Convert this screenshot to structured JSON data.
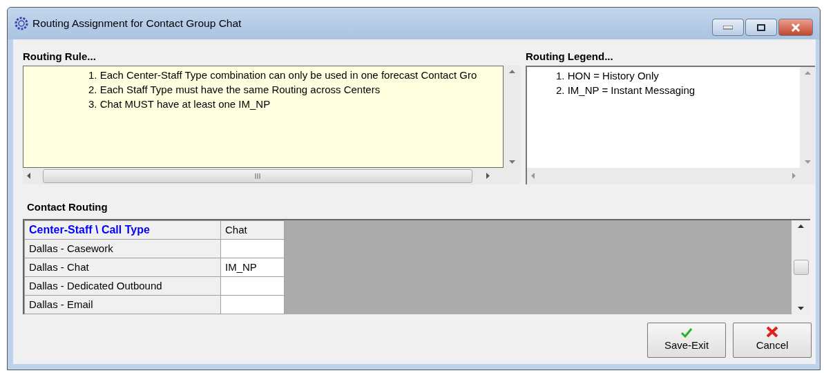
{
  "window": {
    "title": "Routing Assignment for Contact Group Chat"
  },
  "routing_rule": {
    "label": "Routing Rule...",
    "lines": [
      "1. Each Center-Staff Type combination can only be used in one forecast Contact Gro",
      "2. Each Staff Type must have the same Routing across Centers",
      "3. Chat MUST have at least one IM_NP"
    ]
  },
  "routing_legend": {
    "label": "Routing Legend...",
    "lines": [
      "1. HON = History Only",
      "2. IM_NP = Instant Messaging"
    ]
  },
  "contact_routing": {
    "label": "Contact Routing",
    "columns": [
      "Center-Staff \\ Call Type",
      "Chat"
    ],
    "rows": [
      {
        "name": "Dallas - Casework",
        "chat": ""
      },
      {
        "name": "Dallas - Chat",
        "chat": "IM_NP"
      },
      {
        "name": "Dallas - Dedicated Outbound",
        "chat": ""
      },
      {
        "name": "Dallas - Email",
        "chat": ""
      }
    ]
  },
  "buttons": [
    {
      "label": "Save-Exit",
      "kind": "save"
    },
    {
      "label": "Cancel",
      "kind": "cancel"
    }
  ]
}
